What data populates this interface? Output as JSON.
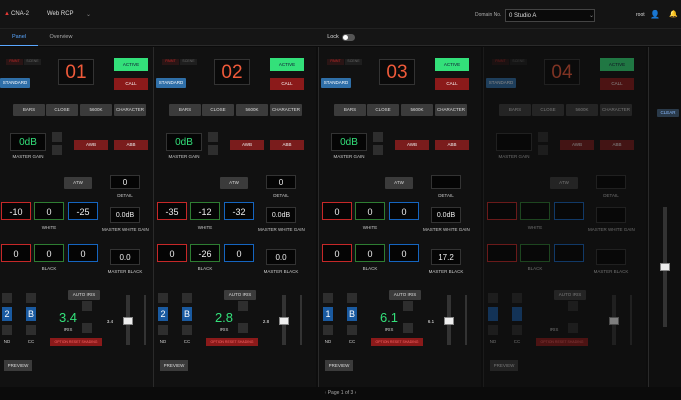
{
  "app": {
    "title": "CNA-2",
    "mode": "Web RCP",
    "domain_label": "Domain No.",
    "domain_value": "0 Studio A",
    "user": "root",
    "icons": [
      "user-icon",
      "bell-icon"
    ]
  },
  "tabs": [
    {
      "label": "Panel",
      "active": true
    },
    {
      "label": "Overview",
      "active": false
    }
  ],
  "lock": {
    "label": "Lock",
    "on": false
  },
  "panels": [
    {
      "number": "01",
      "active_label": "ACTIVE",
      "call_label": "CALL",
      "standard_label": "STANDARD",
      "tags": [
        "PAINT",
        "SCENE"
      ],
      "mode_buttons": [
        "BARS",
        "CLOSE",
        "5600K",
        "CHARACTER"
      ],
      "master_gain": "0dB",
      "master_gain_label": "MASTER GAIN",
      "awb": "AWB",
      "abb": "ABB",
      "atw": "ATW",
      "detail_value": "0",
      "detail_label": "DETAIL",
      "white": [
        "-10",
        "0",
        "-25"
      ],
      "white_label": "WHITE",
      "white_gain": "0.0dB",
      "white_gain_label": "MASTER WHITE GAIN",
      "black": [
        "0",
        "0",
        "0"
      ],
      "black_label": "BLACK",
      "master_black": "0.0",
      "master_black_label": "MASTER BLACK",
      "nd": "2",
      "cc": "B",
      "nd_label": "ND",
      "cc_label": "CC",
      "auto_iris": "AUTO IRIS",
      "iris": "3.4",
      "iris_label": "IRIS",
      "iris_marker": "3.4",
      "strip": "OPTION RESET SHADING",
      "preview": "PREVIEW"
    },
    {
      "number": "02",
      "active_label": "ACTIVE",
      "call_label": "CALL",
      "standard_label": "STANDARD",
      "tags": [
        "PAINT",
        "SCENE"
      ],
      "mode_buttons": [
        "BARS",
        "CLOSE",
        "5600K",
        "CHARACTER"
      ],
      "master_gain": "0dB",
      "master_gain_label": "MASTER GAIN",
      "awb": "AWB",
      "abb": "ABB",
      "atw": "ATW",
      "detail_value": "0",
      "detail_label": "DETAIL",
      "white": [
        "-35",
        "-12",
        "-32"
      ],
      "white_label": "WHITE",
      "white_gain": "0.0dB",
      "white_gain_label": "MASTER WHITE GAIN",
      "black": [
        "0",
        "-26",
        "0"
      ],
      "black_label": "BLACK",
      "master_black": "0.0",
      "master_black_label": "MASTER BLACK",
      "nd": "2",
      "cc": "B",
      "nd_label": "ND",
      "cc_label": "CC",
      "auto_iris": "AUTO IRIS",
      "iris": "2.8",
      "iris_label": "IRIS",
      "iris_marker": "2.8",
      "strip": "OPTION RESET SHADING",
      "preview": "PREVIEW"
    },
    {
      "number": "03",
      "active_label": "ACTIVE",
      "call_label": "CALL",
      "standard_label": "STANDARD",
      "tags": [
        "PAINT",
        "SCENE"
      ],
      "mode_buttons": [
        "BARS",
        "CLOSE",
        "5600K",
        "CHARACTER"
      ],
      "master_gain": "0dB",
      "master_gain_label": "MASTER GAIN",
      "awb": "AWB",
      "abb": "ABB",
      "atw": "ATW",
      "detail_value": "",
      "detail_label": "DETAIL",
      "white": [
        "0",
        "0",
        "0"
      ],
      "white_label": "WHITE",
      "white_gain": "0.0dB",
      "white_gain_label": "MASTER WHITE GAIN",
      "black": [
        "0",
        "0",
        "0"
      ],
      "black_label": "BLACK",
      "master_black": "17.2",
      "master_black_label": "MASTER BLACK",
      "nd": "1",
      "cc": "B",
      "nd_label": "ND",
      "cc_label": "CC",
      "auto_iris": "AUTO IRIS",
      "iris": "6.1",
      "iris_label": "IRIS",
      "iris_marker": "6.1",
      "strip": "OPTION RESET SHADING",
      "preview": "PREVIEW"
    },
    {
      "number": "04",
      "active_label": "ACTIVE",
      "call_label": "CALL",
      "standard_label": "STANDARD",
      "tags": [
        "PAINT",
        "SCENE"
      ],
      "mode_buttons": [
        "BARS",
        "CLOSE",
        "5600K",
        "CHARACTER"
      ],
      "master_gain": "",
      "master_gain_label": "MASTER GAIN",
      "awb": "AWB",
      "abb": "ABB",
      "atw": "ATW",
      "detail_value": "",
      "detail_label": "DETAIL",
      "white": [
        "",
        "",
        ""
      ],
      "white_label": "WHITE",
      "white_gain": "",
      "white_gain_label": "MASTER WHITE GAIN",
      "black": [
        "",
        "",
        ""
      ],
      "black_label": "BLACK",
      "master_black": "",
      "master_black_label": "MASTER BLACK",
      "nd": "",
      "cc": "",
      "nd_label": "ND",
      "cc_label": "CC",
      "auto_iris": "AUTO IRIS",
      "iris": "",
      "iris_label": "IRIS",
      "iris_marker": "",
      "strip": "OPTION RESET SHADING",
      "preview": "PREVIEW"
    }
  ],
  "right": {
    "clear_label": "CLEAR"
  },
  "footer": {
    "page": "Page 1 of 3"
  },
  "colors": {
    "accent_green": "#33e07a",
    "call_red": "#8b1a1a",
    "number_orange": "#ef5a3a",
    "tab_blue": "#5aa7ff"
  }
}
